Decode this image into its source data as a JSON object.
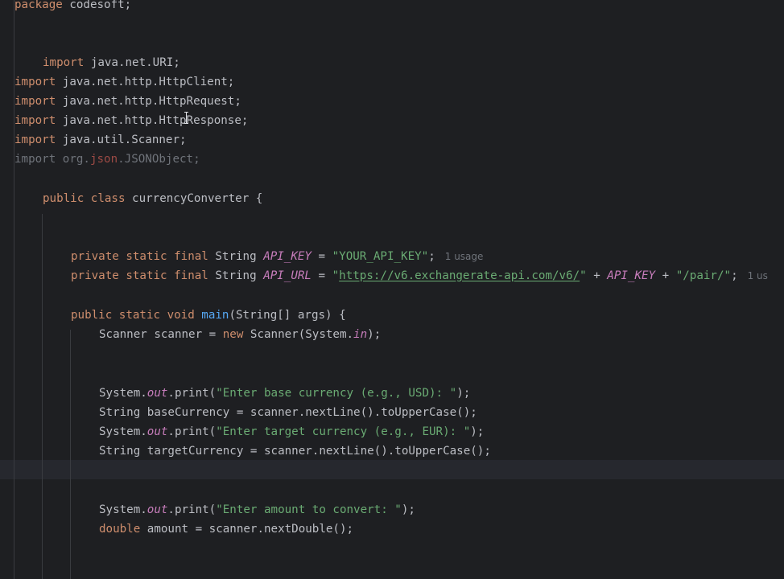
{
  "code": {
    "package_kw": "package",
    "package_name": " codesoft;",
    "imports": {
      "kw": "import",
      "uri": " java.net.URI;",
      "httpclient": " java.net.http.HttpClient;",
      "httprequest": " java.net.http.HttpRequest;",
      "httpresponse": " java.net.http.HttpResponse;",
      "scanner": " java.util.Scanner;",
      "json_prefix": " org.",
      "json_red": "json",
      "json_suffix": ".JSONObject;"
    },
    "class_decl": {
      "kw": "public class",
      "name": " currencyConverter {"
    },
    "api_key_line": {
      "mods": "private static final",
      "type": " String ",
      "name": "API_KEY",
      "assign": " = ",
      "value": "\"YOUR_API_KEY\"",
      "end": ";",
      "hint": "1 usage"
    },
    "api_url_line": {
      "mods": "private static final",
      "type": " String ",
      "name": "API_URL",
      "assign": " = ",
      "q_open": "\"",
      "url": "https://v6.exchangerate-api.com/v6/",
      "q_close": "\"",
      "plus1": " + ",
      "ref": "API_KEY",
      "plus2": " + ",
      "pair": "\"/pair/\"",
      "end": ";",
      "hint": "1 us"
    },
    "main_decl": {
      "kw": "public static void",
      "name": "main",
      "params": "(String[] args) {"
    },
    "scanner_line": {
      "a": "Scanner scanner = ",
      "new": "new",
      "b": " Scanner(System.",
      "in": "in",
      "c": ");"
    },
    "print1": {
      "a": "System.",
      "out": "out",
      "b": ".print(",
      "str": "\"Enter base currency (e.g., USD): \"",
      "c": ");"
    },
    "base_line": "String baseCurrency = scanner.nextLine().toUpperCase();",
    "print2": {
      "a": "System.",
      "out": "out",
      "b": ".print(",
      "str": "\"Enter target currency (e.g., EUR): \"",
      "c": ");"
    },
    "target_line": "String targetCurrency = scanner.nextLine().toUpperCase();",
    "print3": {
      "a": "System.",
      "out": "out",
      "b": ".print(",
      "str": "\"Enter amount to convert: \"",
      "c": ");"
    },
    "amount_line": {
      "kw": "double",
      "rest": " amount = scanner.nextDouble();"
    }
  },
  "colors": {
    "background": "#1e1f22",
    "keyword": "#cf8e6d",
    "string": "#6aab73",
    "static_field": "#c77dbb",
    "method": "#56a8f5",
    "text": "#bcbec4"
  }
}
